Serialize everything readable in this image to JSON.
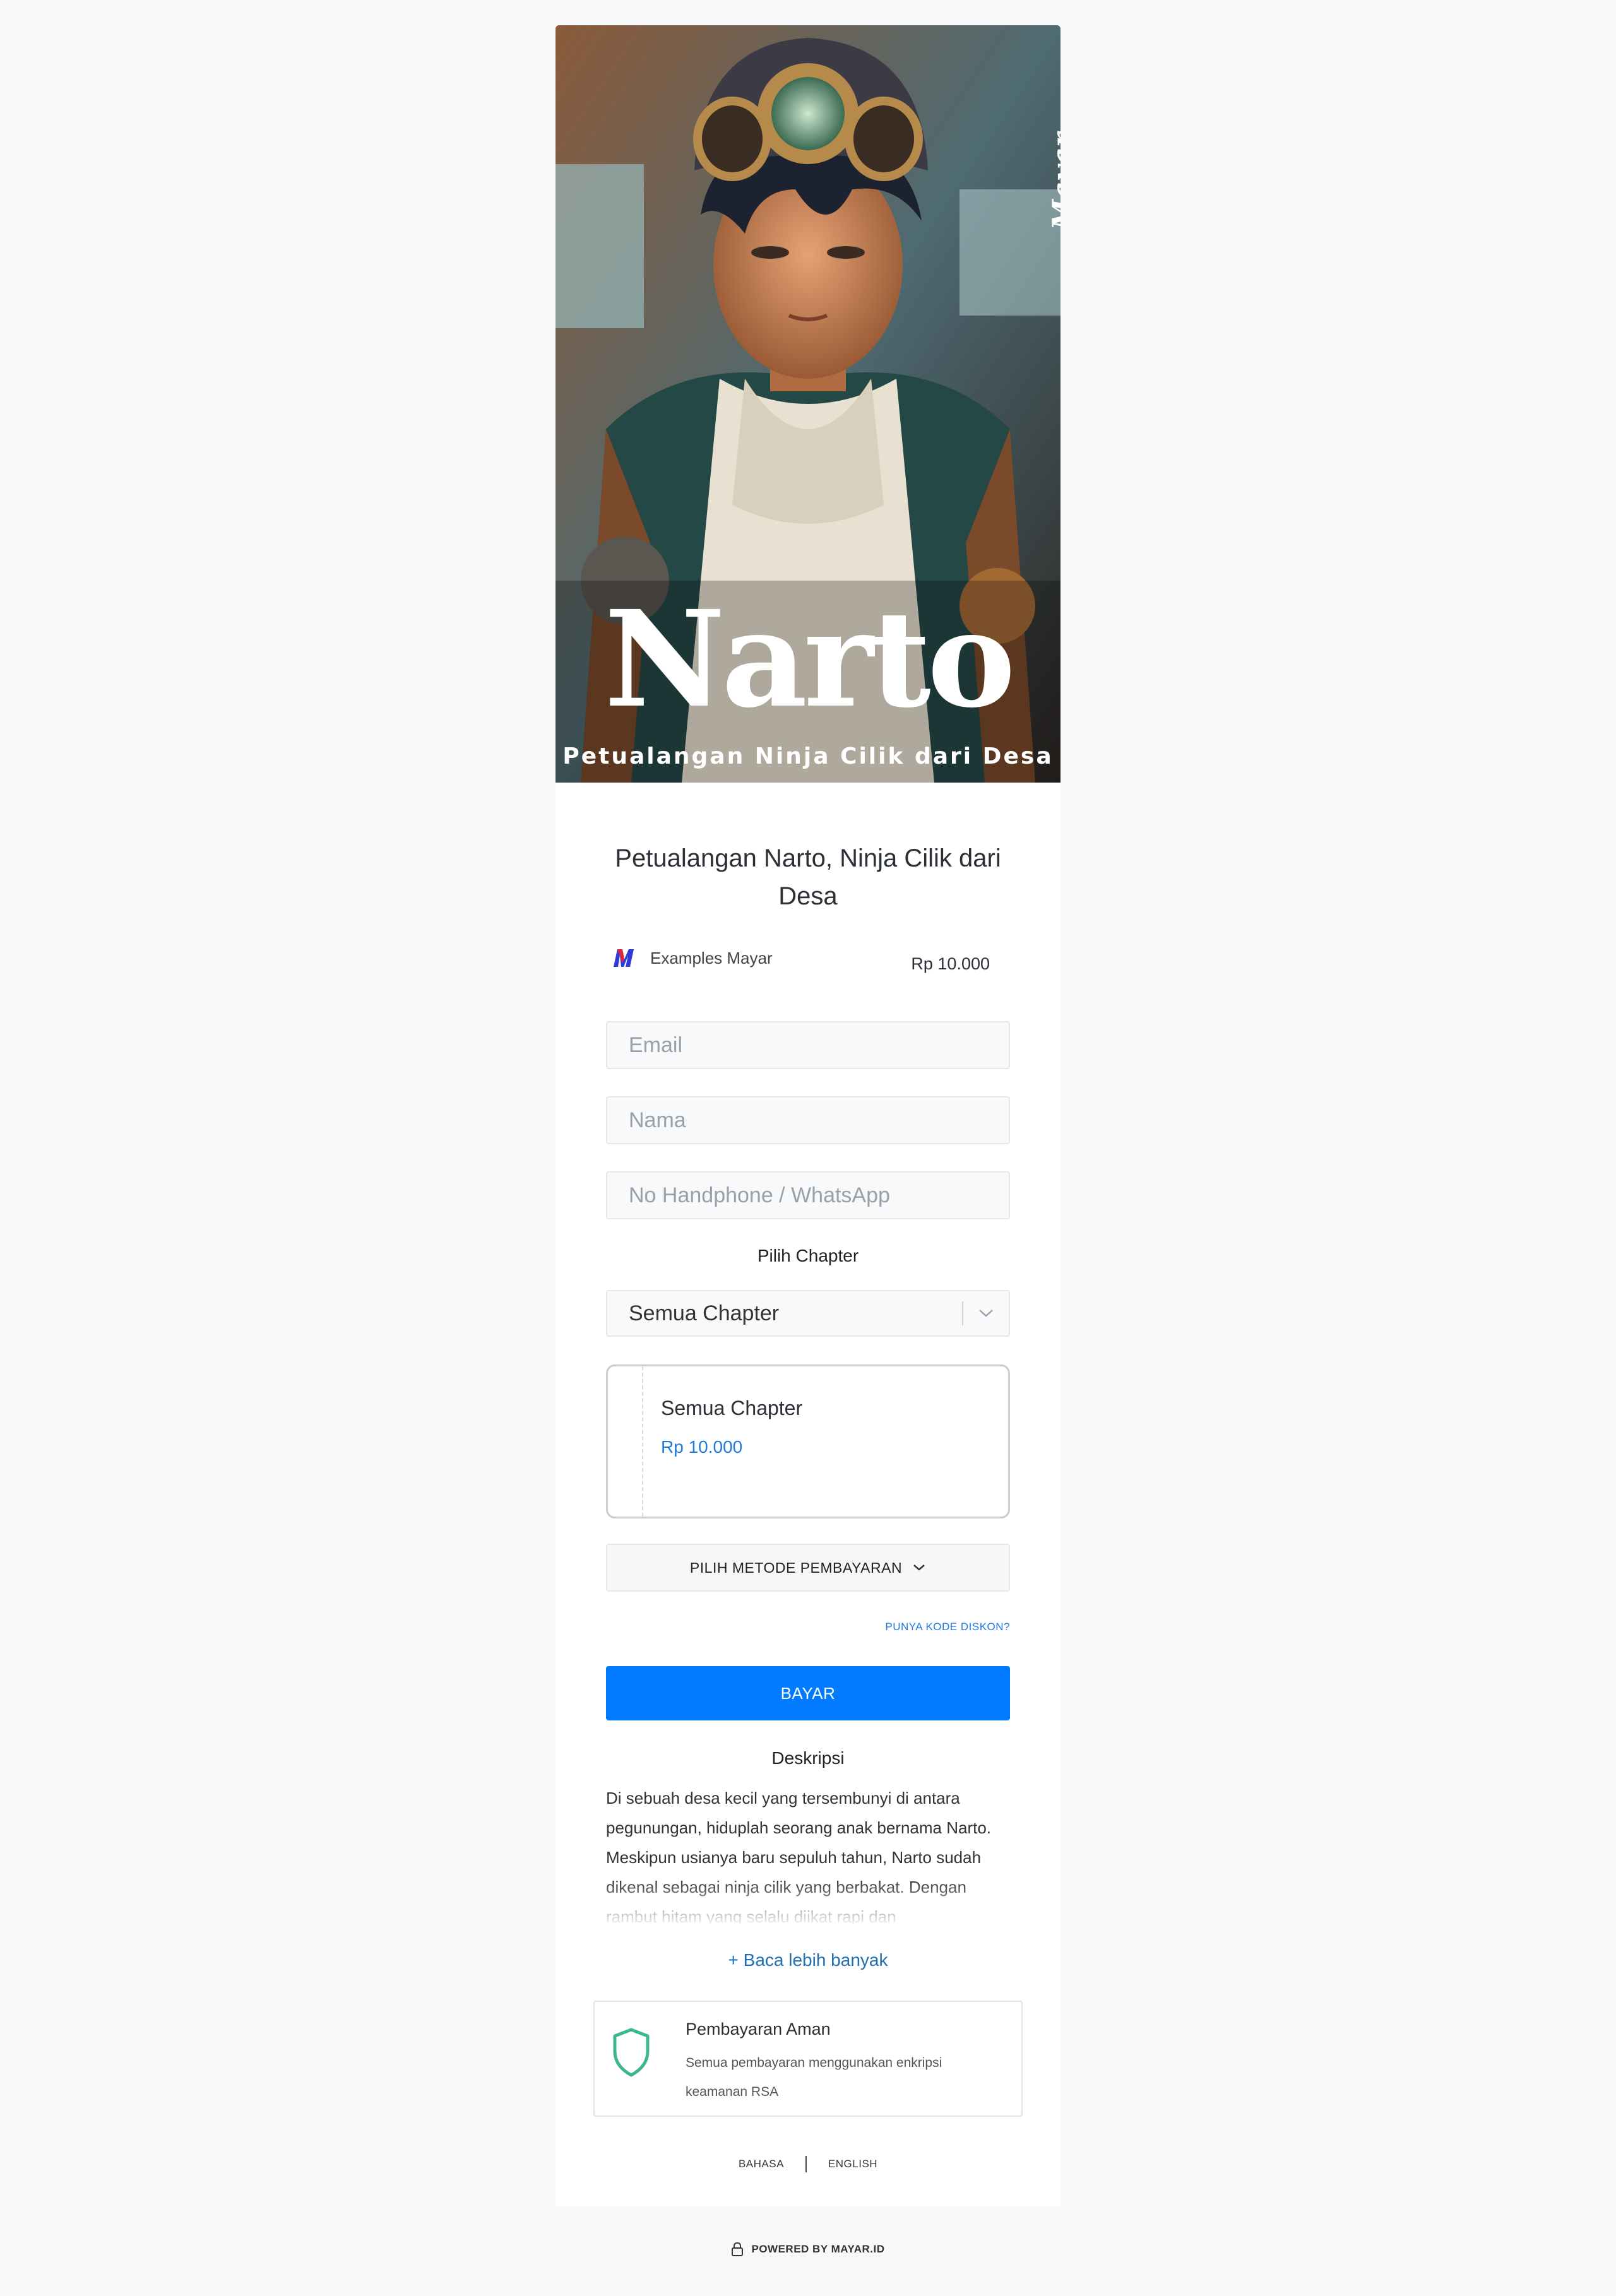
{
  "hero": {
    "brand": "Mayar",
    "title": "Narto",
    "subtitle": "Petualangan Ninja Cilik dari Desa"
  },
  "product": {
    "title": "Petualangan Narto, Ninja Cilik dari Desa",
    "merchant_logo": "mayar-m-logo",
    "merchant_name": "Examples Mayar",
    "price": "Rp 10.000"
  },
  "form": {
    "email_placeholder": "Email",
    "name_placeholder": "Nama",
    "phone_placeholder": "No Handphone / WhatsApp"
  },
  "chapter": {
    "label": "Pilih Chapter",
    "selected": "Semua Chapter",
    "option_name": "Semua Chapter",
    "option_price": "Rp 10.000"
  },
  "payment": {
    "method_label": "PILIH METODE PEMBAYARAN",
    "discount_link": "PUNYA KODE DISKON?",
    "pay_label": "BAYAR"
  },
  "description": {
    "heading": "Deskripsi",
    "text": "Di sebuah desa kecil yang tersembunyi di antara pegunungan, hiduplah seorang anak bernama Narto. Meskipun usianya baru sepuluh tahun, Narto sudah dikenal sebagai ninja cilik yang berbakat. Dengan rambut hitam yang selalu diikat rapi dan",
    "read_more": "+ Baca lebih banyak"
  },
  "secure": {
    "title": "Pembayaran Aman",
    "text": "Semua pembayaran menggunakan enkripsi keamanan RSA",
    "icon": "shield-icon",
    "icon_color": "#3cb98a"
  },
  "language": {
    "bahasa": "BAHASA",
    "english": "ENGLISH"
  },
  "footer": {
    "powered": "POWERED BY MAYAR.ID"
  },
  "colors": {
    "primary": "#007bff",
    "link": "#1f7ae0",
    "background": "#f7f8fa"
  }
}
